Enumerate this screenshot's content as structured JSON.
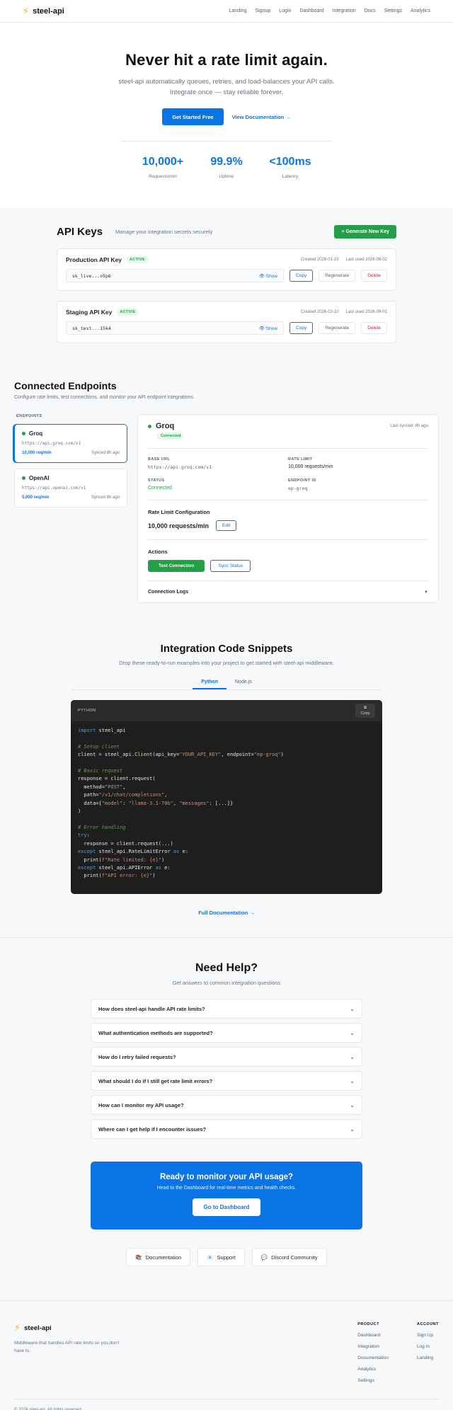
{
  "header": {
    "brand": "steel-api",
    "nav": [
      "Landing",
      "Signup",
      "Login",
      "Dashboard",
      "Integration",
      "Docs",
      "Settings",
      "Analytics"
    ]
  },
  "hero": {
    "title": "Never hit a rate limit again.",
    "subtitle_line1": "steel-api automatically queues, retries, and load-balances your API calls.",
    "subtitle_line2": "Integrate once — stay reliable forever.",
    "cta_primary": "Get Started Free",
    "cta_secondary": "View Documentation →",
    "stats": [
      {
        "value": "10,000+",
        "label": "Requests/min"
      },
      {
        "value": "99.9%",
        "label": "Uptime"
      },
      {
        "value": "<100ms",
        "label": "Latency"
      }
    ]
  },
  "api_keys": {
    "title": "API Keys",
    "subtitle": "Manage your integration secrets securely",
    "generate_label": "+ Generate New Key",
    "keys": [
      {
        "name": "Production API Key",
        "status": "ACTIVE",
        "created": "Created 2026-01-15",
        "last_used": "Last used 2026-08-02",
        "masked": "sk_live...o5p6",
        "show": "Show",
        "copy": "Copy",
        "regen": "Regenerate",
        "delete": "Delete"
      },
      {
        "name": "Staging API Key",
        "status": "ACTIVE",
        "created": "Created 2026-02-10",
        "last_used": "Last used 2026-09-01",
        "masked": "sk_test...15k4",
        "show": "Show",
        "copy": "Copy",
        "regen": "Regenerate",
        "delete": "Delete"
      }
    ]
  },
  "endpoints": {
    "title": "Connected Endpoints",
    "subtitle": "Configure rate limits, test connections, and monitor your API endpoint integrations.",
    "list_label": "ENDPOINTS",
    "items": [
      {
        "name": "Groq",
        "url": "https://api.groq.com/v1",
        "rate": "10,000 req/min",
        "synced": "Synced 8h ago"
      },
      {
        "name": "OpenAI",
        "url": "https://api.openai.com/v1",
        "rate": "5,000 req/min",
        "synced": "Synced 8h ago"
      }
    ],
    "detail": {
      "name": "Groq",
      "status_badge": "Connected",
      "last_synced": "Last synced: 8h ago",
      "base_url_label": "BASE URL",
      "base_url": "https://api.groq.com/v1",
      "rate_limit_label": "RATE LIMIT",
      "rate_limit": "10,000 requests/min",
      "status_label": "STATUS",
      "status": "Connected",
      "endpoint_id_label": "ENDPOINT ID",
      "endpoint_id": "ep-groq",
      "rl_config_title": "Rate Limit Configuration",
      "rl_value": "10,000 requests/min",
      "edit": "Edit",
      "actions_title": "Actions",
      "test": "Test Connection",
      "sync": "Sync Status",
      "logs": "Connection Logs"
    }
  },
  "snippets": {
    "title": "Integration Code Snippets",
    "subtitle": "Drop these ready-to-run examples into your project to get started with steel-api middleware.",
    "tabs": [
      "Python",
      "Node.js"
    ],
    "lang": "PYTHON",
    "copy": "Copy",
    "full_docs": "Full Documentation →"
  },
  "help": {
    "title": "Need Help?",
    "subtitle": "Get answers to common integration questions",
    "faqs": [
      "How does steel-api handle API rate limits?",
      "What authentication methods are supported?",
      "How do I retry failed requests?",
      "What should I do if I still get rate limit errors?",
      "How can I monitor my API usage?",
      "Where can I get help if I encounter issues?"
    ],
    "cta_title": "Ready to monitor your API usage?",
    "cta_sub": "Head to the Dashboard for real-time metrics and health checks.",
    "cta_button": "Go to Dashboard",
    "resources": [
      {
        "icon": "book-icon",
        "label": "Documentation"
      },
      {
        "icon": "mail-icon",
        "label": "Support"
      },
      {
        "icon": "chat-icon",
        "label": "Discord Community"
      }
    ]
  },
  "footer": {
    "brand": "steel-api",
    "desc": "Middleware that handles API rate limits so you don't have to.",
    "product_title": "PRODUCT",
    "product": [
      "Dashboard",
      "Integration",
      "Documentation",
      "Analytics",
      "Settings"
    ],
    "account_title": "ACCOUNT",
    "account": [
      "Sign Up",
      "Log In",
      "Landing"
    ],
    "copyright": "© 2024 steel-api. All rights reserved."
  },
  "colors": {
    "accent": "#0b74e5",
    "success": "#23a047",
    "danger": "#d1242f",
    "code_bg": "#1e1e1e"
  }
}
